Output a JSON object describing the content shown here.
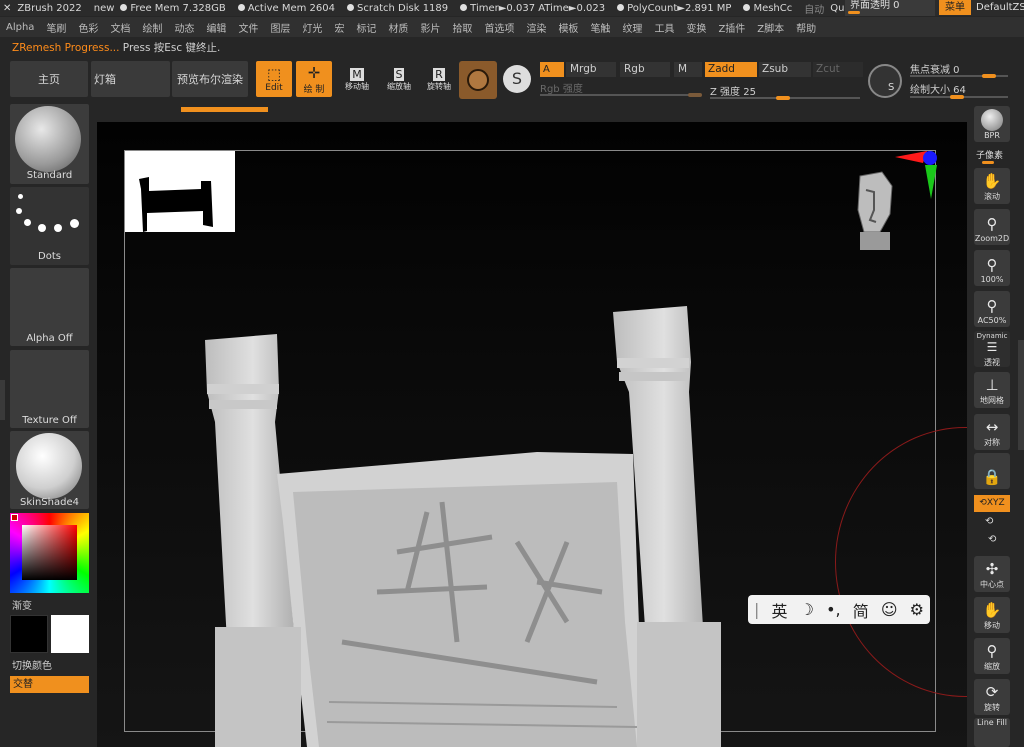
{
  "titlebar": {
    "app": "ZBrush 2022",
    "doc": "new",
    "free_mem": "Free Mem 7.328GB",
    "active_mem": "Active Mem 2604",
    "scratch": "Scratch Disk 1189",
    "timer": "Timer►0.037 ATime►0.023",
    "polycount": "PolyCount►2.891 MP",
    "meshcc": "MeshCc",
    "auto": "自动",
    "quicksave": "QuickSave",
    "interface_opacity": "界面透明 0",
    "menu_button": "菜单",
    "default_script": "DefaultZS"
  },
  "menubar": [
    "Alpha",
    "笔刷",
    "色彩",
    "文档",
    "绘制",
    "动态",
    "编辑",
    "文件",
    "图层",
    "灯光",
    "宏",
    "标记",
    "材质",
    "影片",
    "拾取",
    "首选项",
    "渲染",
    "模板",
    "笔触",
    "纹理",
    "工具",
    "变换",
    "Z插件",
    "Z脚本",
    "帮助"
  ],
  "notice": {
    "highlight": "ZRemesh Progress...",
    "text": "Press 按Esc 键终止."
  },
  "toolbar": {
    "home": "主页",
    "lightbox": "灯箱",
    "preview_render": "预览布尔渲染",
    "edit": "Edit",
    "draw": "绘 制",
    "move": "移动轴",
    "scale": "缩放轴",
    "rotate": "旋转轴",
    "a": "A",
    "mrgb": "Mrgb",
    "rgb": "Rgb",
    "m": "M",
    "zadd": "Zadd",
    "zsub": "Zsub",
    "zcut": "Zcut",
    "rgb_intensity": "Rgb 强度",
    "z_intensity": "Z 强度 25",
    "focal_shift": "焦点衰减 0",
    "draw_size": "绘制大小 64"
  },
  "left_shelf": {
    "brush": "Standard",
    "stroke": "Dots",
    "alpha": "Alpha Off",
    "texture": "Texture Off",
    "material": "SkinShade4",
    "gradient": "渐变",
    "switch_color": "切换颜色",
    "alternate": "交替"
  },
  "right_shelf": {
    "bpr": "BPR",
    "subpixel": "子像素",
    "scroll": "滚动",
    "zoom2d": "Zoom2D",
    "pct100": "100%",
    "ac50": "AC50%",
    "dynamic": "Dynamic",
    "persp": "透视",
    "floor": "地网格",
    "sym": "对称",
    "lock": "",
    "xyz": "XYZ",
    "center": "中心点",
    "move": "移动",
    "zoom": "缩放",
    "rotate": "旋转",
    "linefill": "Line Fill"
  },
  "ime": {
    "lang": "英",
    "moon": "☽",
    "punct": "•,",
    "simp": "简",
    "emoji": "☺",
    "settings": "⚙"
  },
  "colors": {
    "accent": "#f0901e",
    "panel": "#3a3a3a",
    "bg": "#262626"
  }
}
